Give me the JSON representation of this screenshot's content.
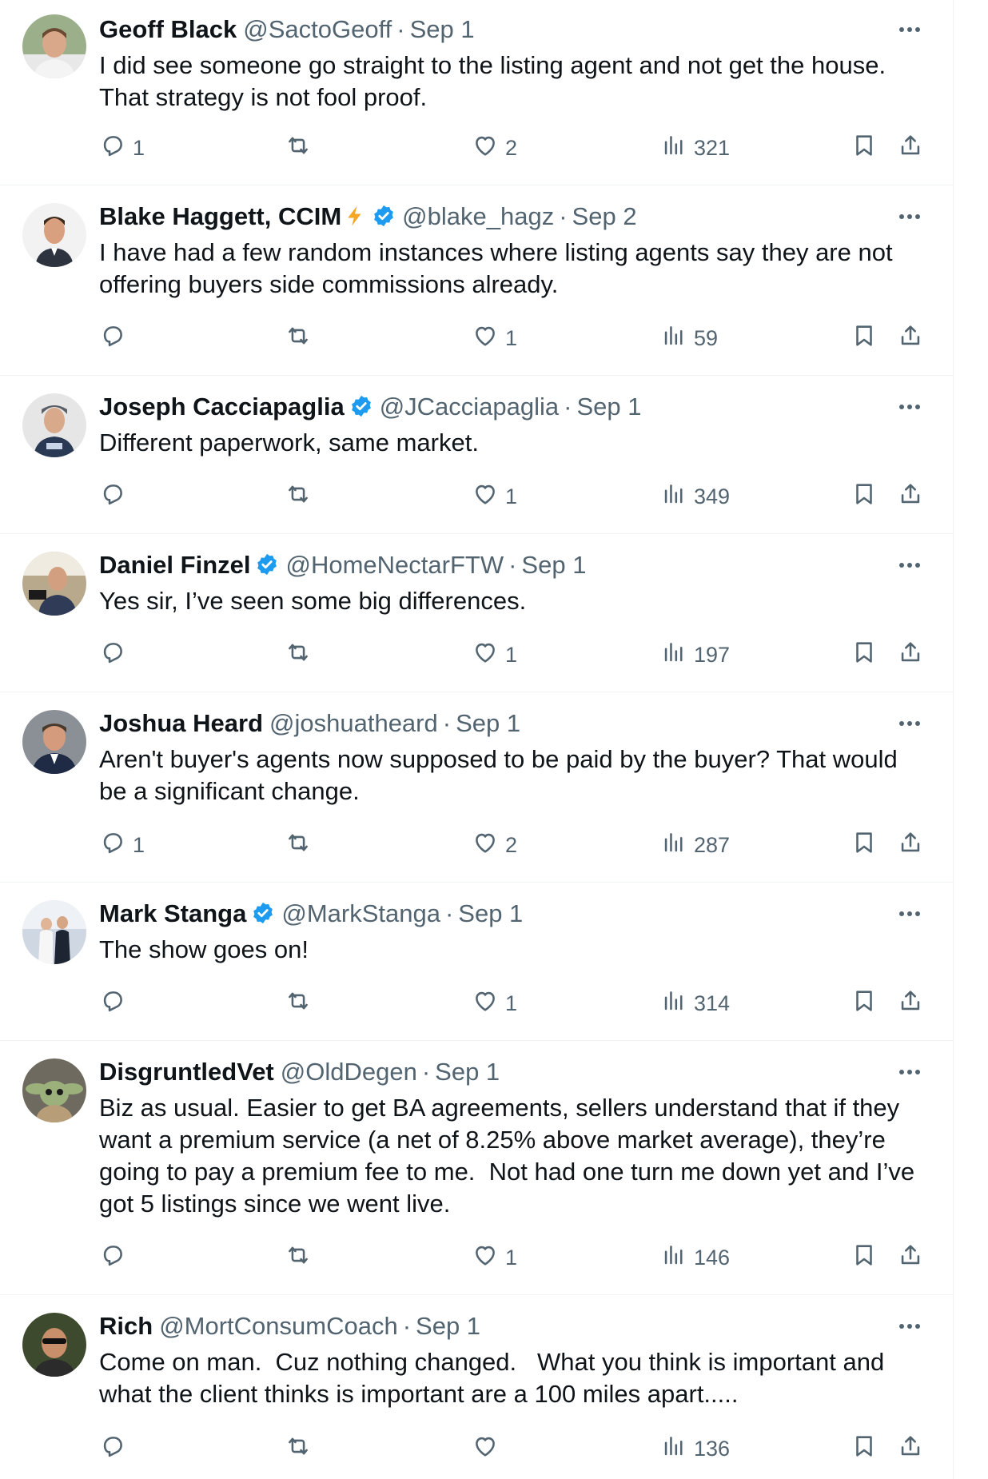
{
  "colors": {
    "text": "#0f1419",
    "secondary": "#536471",
    "verified": "#1d9bf0",
    "divider": "#eff3f4",
    "bolt": "#f5a623"
  },
  "tweets": [
    {
      "name": "Geoff Black",
      "handle": "@SactoGeoff",
      "sep": "·",
      "date": "Sep 1",
      "verified": false,
      "bolt": false,
      "text": "I did see someone go straight to the listing agent and not get the house. That strategy is not fool proof.",
      "replies": "1",
      "retweets": "",
      "likes": "2",
      "views": "321"
    },
    {
      "name": "Blake Haggett, CCIM",
      "handle": "@blake_hagz",
      "sep": "·",
      "date": "Sep 2",
      "verified": true,
      "bolt": true,
      "text": "I have had a few random instances where listing agents say they are not offering buyers side commissions already.",
      "replies": "",
      "retweets": "",
      "likes": "1",
      "views": "59"
    },
    {
      "name": "Joseph Cacciapaglia",
      "handle": "@JCacciapaglia",
      "sep": "·",
      "date": "Sep 1",
      "verified": true,
      "bolt": false,
      "text": "Different paperwork, same market.",
      "replies": "",
      "retweets": "",
      "likes": "1",
      "views": "349"
    },
    {
      "name": "Daniel Finzel",
      "handle": "@HomeNectarFTW",
      "sep": "·",
      "date": "Sep 1",
      "verified": true,
      "bolt": false,
      "text": "Yes sir, I’ve seen some big differences.",
      "replies": "",
      "retweets": "",
      "likes": "1",
      "views": "197"
    },
    {
      "name": "Joshua Heard",
      "handle": "@joshuatheard",
      "sep": "·",
      "date": "Sep 1",
      "verified": false,
      "bolt": false,
      "text": "Aren't buyer's agents now supposed to be paid by the buyer? That would be a significant change.",
      "replies": "1",
      "retweets": "",
      "likes": "2",
      "views": "287"
    },
    {
      "name": "Mark Stanga",
      "handle": "@MarkStanga",
      "sep": "·",
      "date": "Sep 1",
      "verified": true,
      "bolt": false,
      "text": "The show goes on!",
      "replies": "",
      "retweets": "",
      "likes": "1",
      "views": "314"
    },
    {
      "name": "DisgruntledVet",
      "handle": "@OldDegen",
      "sep": "·",
      "date": "Sep 1",
      "verified": false,
      "bolt": false,
      "text": "Biz as usual. Easier to get BA agreements, sellers understand that if they want a premium service (a net of 8.25% above market average), they’re going to pay a premium fee to me.  Not had one turn me down yet and I’ve got 5 listings since we went live.",
      "replies": "",
      "retweets": "",
      "likes": "1",
      "views": "146"
    },
    {
      "name": "Rich",
      "handle": "@MortConsumCoach",
      "sep": "·",
      "date": "Sep 1",
      "verified": false,
      "bolt": false,
      "text": "Come on man.  Cuz nothing changed.   What you think is important and what the client thinks is important are a 100 miles apart.....",
      "replies": "",
      "retweets": "",
      "likes": "",
      "views": "136"
    }
  ]
}
